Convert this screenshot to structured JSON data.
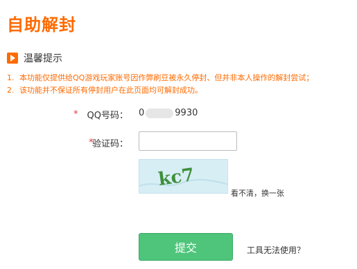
{
  "page": {
    "title": "自助解封"
  },
  "tip": {
    "title": "温馨提示",
    "notes": [
      {
        "num": "1.",
        "text": "本功能仅提供给QQ游戏玩家账号因作弊刷豆被永久停封、但并非本人操作的解封尝试；"
      },
      {
        "num": "2.",
        "text": "该功能并不保证所有停封用户在此页面均可解封成功。"
      }
    ]
  },
  "form": {
    "required_mark": "*",
    "qq_label": "QQ号码：",
    "qq_prefix": "0",
    "qq_suffix": "9930",
    "captcha_label": "验证码：",
    "captcha_value": "",
    "captcha_text": "kc7",
    "refresh_label": "看不清，换一张"
  },
  "actions": {
    "submit_label": "提交",
    "help_label": "工具无法使用？"
  },
  "colors": {
    "accent": "#ff6a00",
    "button": "#4ec57a",
    "required": "#e4393c"
  }
}
